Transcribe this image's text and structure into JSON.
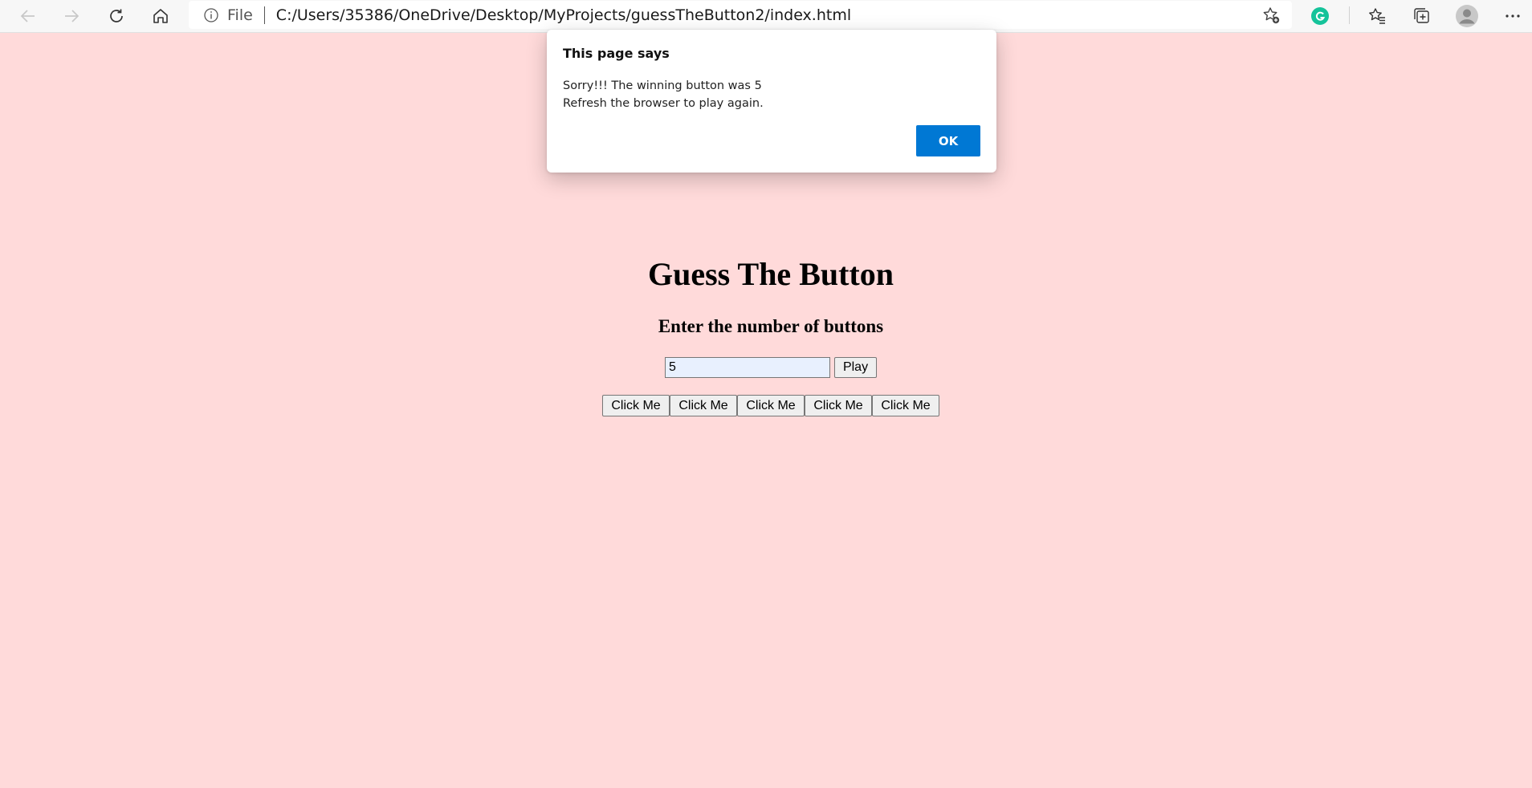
{
  "browser": {
    "address": {
      "scheme_label": "File",
      "url": "C:/Users/35386/OneDrive/Desktop/MyProjects/guessTheButton2/index.html"
    },
    "icons": [
      "back-arrow-icon",
      "forward-arrow-icon",
      "refresh-icon",
      "home-icon",
      "info-icon",
      "favorite-add-icon",
      "grammarly-icon",
      "favorites-icon",
      "collections-icon",
      "profile-avatar-icon",
      "more-options-icon"
    ],
    "accent_color": "#0078d4"
  },
  "dialog": {
    "title": "This page says",
    "message_line1": "Sorry!!! The winning button was 5",
    "message_line2": "Refresh the browser to play again.",
    "ok_label": "OK"
  },
  "page": {
    "background_color": "#ffdada",
    "title": "Guess The Button",
    "subtitle": "Enter the number of buttons",
    "input_value": "5",
    "play_label": "Play",
    "guess_buttons": [
      "Click Me",
      "Click Me",
      "Click Me",
      "Click Me",
      "Click Me"
    ]
  }
}
